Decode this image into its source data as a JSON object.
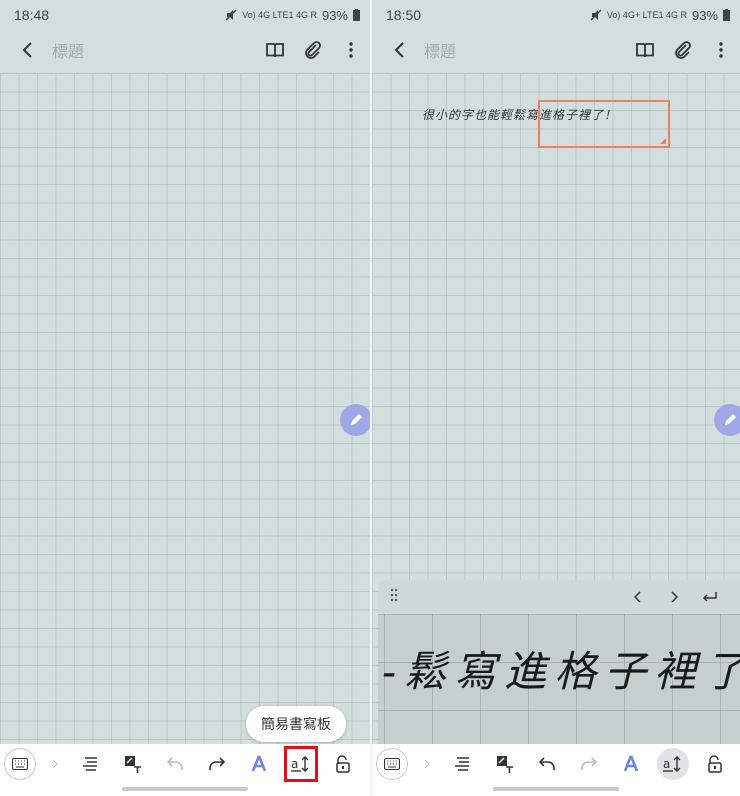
{
  "left_screen": {
    "status": {
      "time": "18:48",
      "network": "Vo) 4G LTE1 4G R",
      "battery": "93%"
    },
    "title_placeholder": "標題",
    "tooltip": "簡易書寫板"
  },
  "right_screen": {
    "status": {
      "time": "18:50",
      "network": "Vo) 4G+ LTE1 4G R",
      "battery": "93%"
    },
    "title_placeholder": "標題",
    "inline_handwriting": "很小的字也能輕鬆寫進格子裡了！",
    "panel_handwriting": "-鬆寫進格子裡了！"
  },
  "icons": {
    "back": "back-arrow-icon",
    "book": "book-view-icon",
    "attach": "paperclip-icon",
    "more": "more-vert-icon",
    "keyboard": "keyboard-icon",
    "align": "text-align-icon",
    "handwriting_to_text": "handwriting-to-text-icon",
    "undo": "undo-icon",
    "redo": "redo-icon",
    "pen_style": "pen-style-icon",
    "easy_writing_pad": "easy-writing-pad-icon",
    "lock": "lock-icon",
    "pen_fab": "pen-fab-icon"
  },
  "colors": {
    "accent": "#9fa8e6",
    "highlight": "#e0101a",
    "selection": "#ef7e62"
  }
}
